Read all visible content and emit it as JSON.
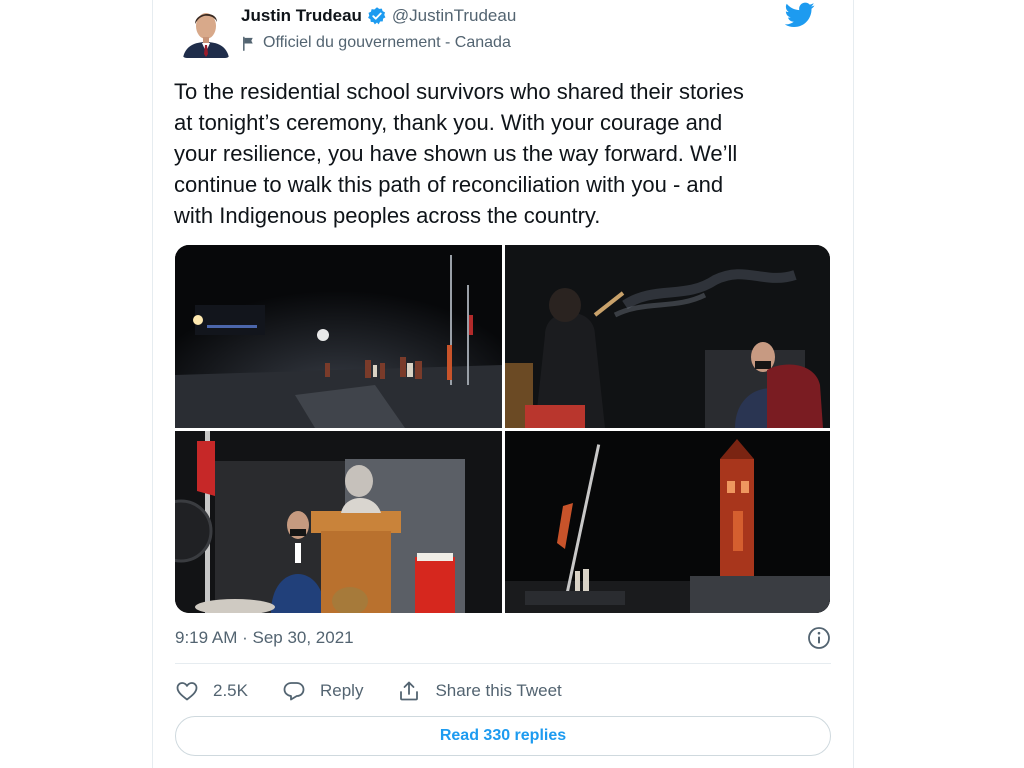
{
  "tweet": {
    "author": {
      "name": "Justin Trudeau",
      "handle": "@JustinTrudeau",
      "label": "Officiel du gouvernement - Canada",
      "verified": true
    },
    "text_lines": [
      "To the residential school survivors who shared their stories",
      "at tonight’s ceremony, thank you. With your courage and",
      "your resilience, you have shown us the way forward. We’ll",
      "continue to walk this path of reconciliation with you - and",
      "with Indigenous peoples across the country."
    ],
    "photos": [
      {
        "icon": "night-ceremony-photo"
      },
      {
        "icon": "smudging-ceremony-photo"
      },
      {
        "icon": "speaker-podium-photo"
      },
      {
        "icon": "peace-tower-photo"
      }
    ],
    "timestamp": "9:19 AM · Sep 30, 2021",
    "actions": {
      "like_count": "2.5K",
      "reply_label": "Reply",
      "share_label": "Share this Tweet"
    },
    "read_replies_label": "Read 330 replies"
  },
  "colors": {
    "accent": "#1d9bf0",
    "text_primary": "#0f1419",
    "text_secondary": "#536471",
    "border": "#e6ecf0"
  }
}
